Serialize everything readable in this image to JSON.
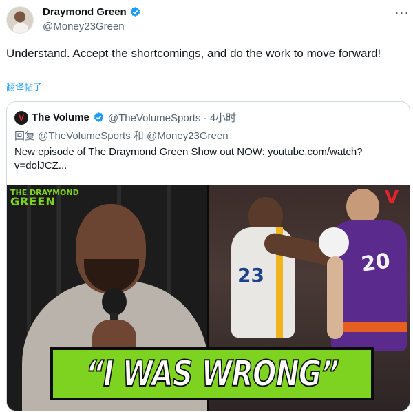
{
  "tweet": {
    "display_name": "Draymond Green",
    "handle": "@Money23Green",
    "text": "Understand. Accept the shortcomings, and do the work to move forward!",
    "translate_label": "翻译帖子",
    "more_icon": "more-icon",
    "verified_color": "#1d9bf0"
  },
  "quote": {
    "logo_letter": "V",
    "display_name": "The Volume",
    "handle_time": "@TheVolumeSports · 4小时",
    "reply_line": "回复 @TheVolumeSports 和 @Money23Green",
    "text": "New episode of The Draymond Green Show out NOW: youtube.com/watch?v=dolJCZ...",
    "media": {
      "show_logo_top": "THE DRAYMOND",
      "show_logo_main": "GREEN",
      "corner_logo": "V",
      "banner_text": "“I WAS WRONG”",
      "left_number": "23",
      "right_number": "20"
    }
  },
  "colors": {
    "accent": "#1d9bf0",
    "banner_green": "#7ed321",
    "volume_red": "#e0242a"
  }
}
